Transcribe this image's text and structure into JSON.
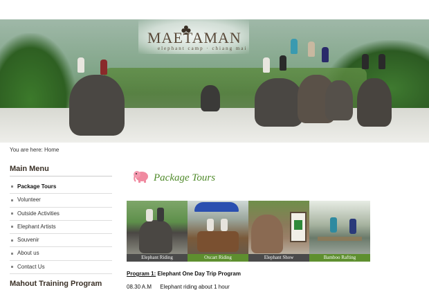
{
  "brand": {
    "name": "MAETAMAN",
    "tagline": "elephant camp · chiang mai"
  },
  "breadcrumb": {
    "prefix": "You are here:",
    "current": "Home"
  },
  "main_menu": {
    "title": "Main Menu",
    "items": [
      {
        "label": "Package Tours",
        "active": true
      },
      {
        "label": "Volunteer",
        "active": false
      },
      {
        "label": "Outside Activities",
        "active": false
      },
      {
        "label": "Elephant Artists",
        "active": false
      },
      {
        "label": "Souvenir",
        "active": false
      },
      {
        "label": "About us",
        "active": false
      },
      {
        "label": "Contact Us",
        "active": false
      }
    ]
  },
  "second_menu": {
    "title": "Mahout Training Program"
  },
  "content": {
    "heading": "Package Tours",
    "tiles": [
      {
        "caption": "Elephant Riding"
      },
      {
        "caption": "Oxcart Riding"
      },
      {
        "caption": "Elephant Show"
      },
      {
        "caption": "Bamboo Rafting"
      }
    ],
    "program": {
      "label": "Program 1:",
      "title": "Elephant One Day Trip Program",
      "schedule": [
        {
          "time": "08.30 A.M",
          "activity": "Elephant riding about 1 hour"
        }
      ]
    }
  },
  "colors": {
    "heading_green": "#4f8a2a",
    "caption_dark": "#4a4a4a",
    "caption_green": "#5e8f2f"
  }
}
